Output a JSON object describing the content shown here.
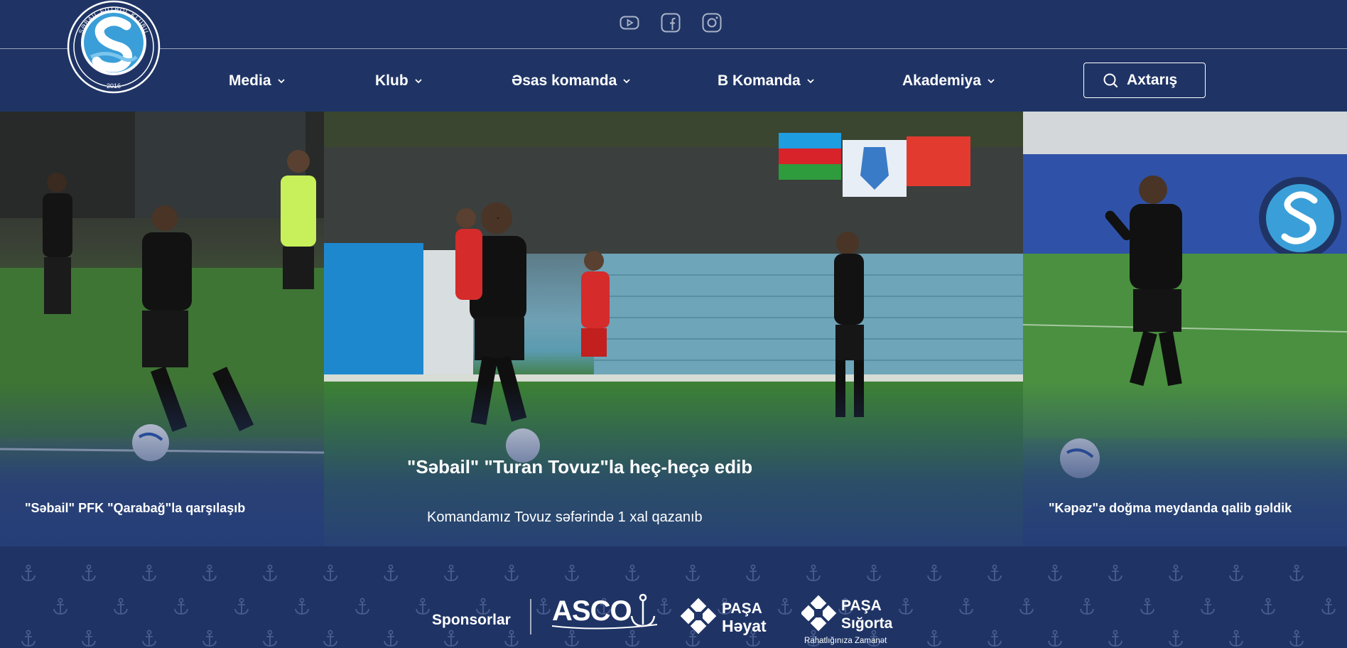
{
  "header": {
    "logo_text": "SƏBAİL FUTBOL KLUBU",
    "logo_year": "2016",
    "social": [
      {
        "icon": "youtube-icon"
      },
      {
        "icon": "facebook-icon"
      },
      {
        "icon": "instagram-icon"
      }
    ],
    "nav": [
      {
        "label": "Media"
      },
      {
        "label": "Klub"
      },
      {
        "label": "Əsas komanda"
      },
      {
        "label": "B Komanda"
      },
      {
        "label": "Akademiya"
      }
    ],
    "search_label": "Axtarış"
  },
  "slider": {
    "left_caption": "\"Səbail\" PFK \"Qarabağ\"la qarşılaşıb",
    "center_title": "\"Səbail\" \"Turan Tovuz\"la heç-heçə edib",
    "center_subtitle": "Komandamız Tovuz səfərində 1 xal qazanıb",
    "right_caption": "\"Kəpəz\"ə doğma meydanda qalib gəldik"
  },
  "sponsors": {
    "label": "Sponsorlar",
    "items": [
      {
        "name": "ASCO"
      },
      {
        "name": "PAŞA",
        "sub": "Həyat"
      },
      {
        "name": "PAŞA",
        "sub": "Sığorta",
        "tagline": "Rahatlığınıza Zamanət"
      }
    ]
  },
  "colors": {
    "primary": "#1f3465",
    "accent": "#3a9fd8",
    "text": "#ffffff"
  }
}
